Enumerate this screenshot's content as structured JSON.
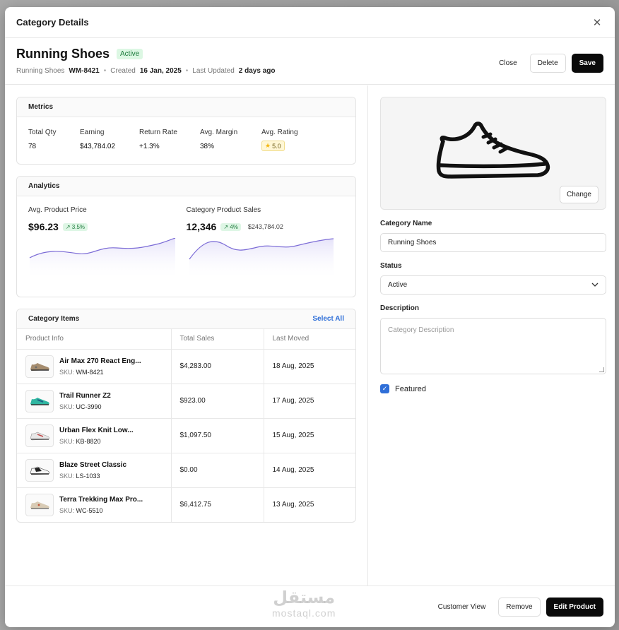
{
  "modal": {
    "title": "Category Details"
  },
  "header": {
    "title": "Running Shoes",
    "status": "Active",
    "breadcrumb": "Running Shoes",
    "code": "WM-8421",
    "created_label": "Created",
    "created": "16 Jan, 2025",
    "updated_label": "Last Updated",
    "updated": "2 days ago",
    "close_label": "Close",
    "delete_label": "Delete",
    "save_label": "Save"
  },
  "metrics": {
    "title": "Metrics",
    "items": [
      {
        "label": "Total Qty",
        "value": "78"
      },
      {
        "label": "Earning",
        "value": "$43,784.02"
      },
      {
        "label": "Return Rate",
        "value": "+1.3%"
      },
      {
        "label": "Avg. Margin",
        "value": "38%"
      },
      {
        "label": "Avg. Rating",
        "value": "5.0"
      }
    ]
  },
  "analytics": {
    "title": "Analytics",
    "price": {
      "label": "Avg. Product Price",
      "value": "$96.23",
      "trend": "3.5%"
    },
    "sales": {
      "label": "Category Product Sales",
      "value": "12,346",
      "trend": "4%",
      "extra": "$243,784.02"
    }
  },
  "items": {
    "title": "Category Items",
    "select_all": "Select All",
    "columns": [
      "Product Info",
      "Total Sales",
      "Last Moved"
    ],
    "sku_label": "SKU:",
    "rows": [
      {
        "name": "Air Max 270 React Eng...",
        "sku": "WM-8421",
        "sales": "$4,283.00",
        "moved": "18 Aug, 2025"
      },
      {
        "name": "Trail Runner Z2",
        "sku": "UC-3990",
        "sales": "$923.00",
        "moved": "17 Aug, 2025"
      },
      {
        "name": "Urban Flex Knit Low...",
        "sku": "KB-8820",
        "sales": "$1,097.50",
        "moved": "15 Aug, 2025"
      },
      {
        "name": "Blaze Street Classic",
        "sku": "LS-1033",
        "sales": "$0.00",
        "moved": "14 Aug, 2025"
      },
      {
        "name": "Terra Trekking Max Pro...",
        "sku": "WC-5510",
        "sales": "$6,412.75",
        "moved": "13 Aug, 2025"
      }
    ]
  },
  "form": {
    "change_label": "Change",
    "name_label": "Category Name",
    "name_value": "Running Shoes",
    "status_label": "Status",
    "status_value": "Active",
    "description_label": "Description",
    "description_placeholder": "Category Description",
    "featured_label": "Featured"
  },
  "footer": {
    "customer_view": "Customer View",
    "remove": "Remove",
    "edit_product": "Edit Product"
  },
  "watermark": {
    "arabic": "مستقل",
    "latin": "mostaql.com"
  },
  "colors": {
    "accent": "#2f6fd8",
    "dark_button": "#0a0a0a",
    "badge_green": "#dcf7e3",
    "chart_line": "#7b6bd6"
  }
}
